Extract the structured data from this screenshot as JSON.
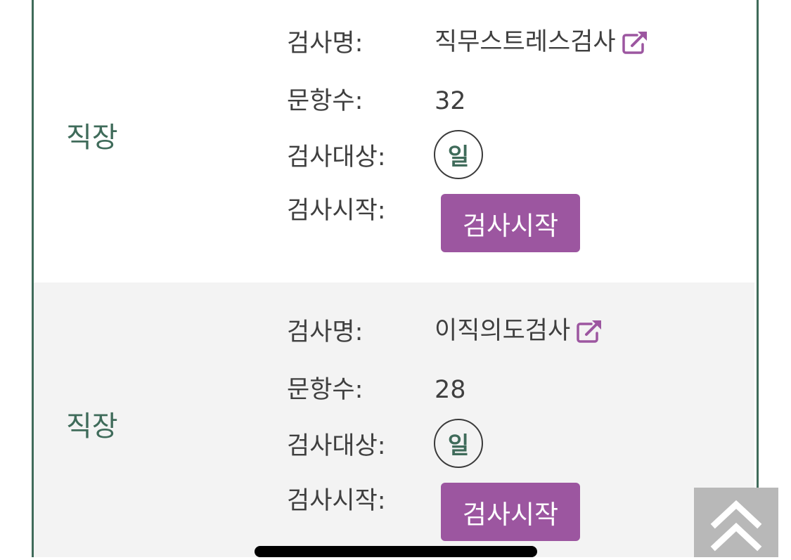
{
  "colors": {
    "accent_green": "#3f6b5a",
    "button_purple": "#9c56a0",
    "row_alt_bg": "#f3f3f3",
    "scroll_button_bg": "#b8b8b8"
  },
  "labels": {
    "name": "검사명:",
    "count": "문항수:",
    "target": "검사대상:",
    "start": "검사시작:"
  },
  "tests": [
    {
      "category": "직장",
      "name": "직무스트레스검사",
      "name_icon": "external-link-icon",
      "count": "32",
      "target": "일",
      "start_button": "검사시작"
    },
    {
      "category": "직장",
      "name": "이직의도검사",
      "name_icon": "external-link-icon",
      "count": "28",
      "target": "일",
      "start_button": "검사시작"
    }
  ],
  "scroll_top_icon": "double-chevron-up-icon"
}
